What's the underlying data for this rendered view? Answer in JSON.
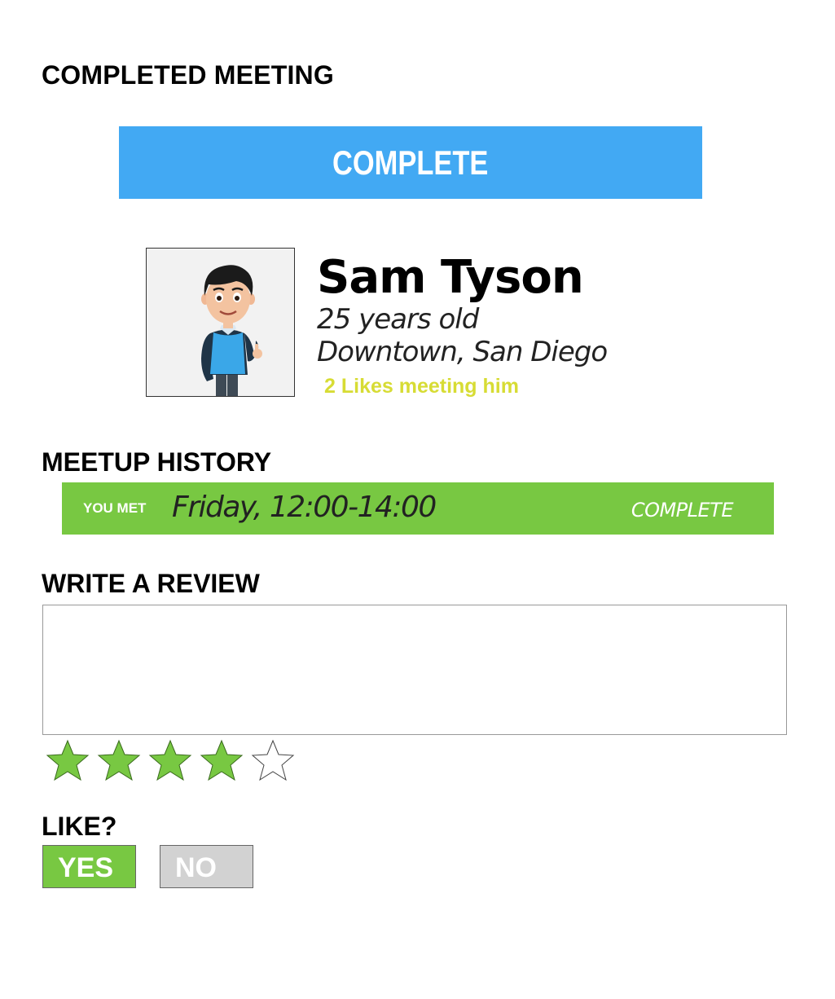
{
  "page": {
    "title": "COMPLETED MEETING"
  },
  "banner": {
    "label": "COMPLETE",
    "color": "#42a9f3"
  },
  "profile": {
    "name": "Sam Tyson",
    "age": "25 years old",
    "location": "Downtown, San Diego",
    "likes_text": "2 Likes meeting him",
    "likes_color": "#d7dc34",
    "avatar_icon": "person-avatar-icon"
  },
  "history": {
    "title": "MEETUP HISTORY",
    "entries": [
      {
        "label": "YOU MET",
        "time": "Friday, 12:00-14:00",
        "status": "COMPLETE",
        "color": "#78c842"
      }
    ]
  },
  "review": {
    "title": "WRITE A REVIEW",
    "value": "",
    "rating": 4,
    "max_rating": 5,
    "star_filled_color": "#78c842",
    "star_icon": "star-icon"
  },
  "like": {
    "title": "LIKE?",
    "yes_label": "YES",
    "no_label": "NO",
    "selected": "YES",
    "yes_color": "#78c842",
    "no_color": "#d2d2d2"
  }
}
